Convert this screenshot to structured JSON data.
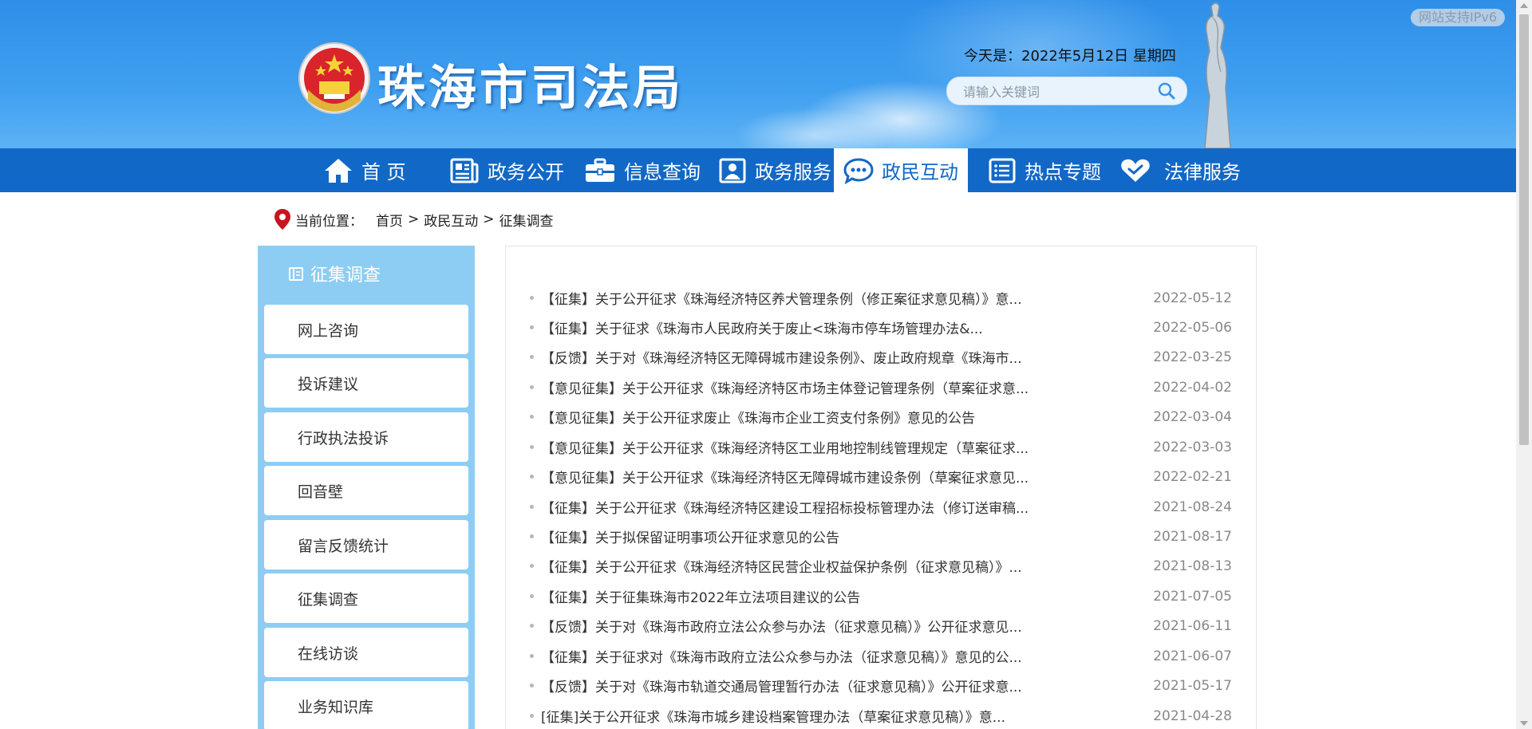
{
  "header": {
    "site_title": "珠海市司法局",
    "date_text": "今天是：2022年5月12日 星期四",
    "search_placeholder": "请输入关键词",
    "ipv6_badge": "网站支持IPv6"
  },
  "nav": {
    "items": [
      {
        "label": "首 页",
        "icon": "home-icon"
      },
      {
        "label": "政务公开",
        "icon": "newspaper-icon"
      },
      {
        "label": "信息查询",
        "icon": "briefcase-icon"
      },
      {
        "label": "政务服务",
        "icon": "user-card-icon"
      },
      {
        "label": "政民互动",
        "icon": "chat-bubble-icon",
        "active": true
      },
      {
        "label": "热点专题",
        "icon": "list-icon"
      },
      {
        "label": "法律服务",
        "icon": "heart-icon"
      }
    ]
  },
  "breadcrumb": {
    "label": "当前位置：",
    "items": [
      "首页",
      "政民互动",
      "征集调查"
    ],
    "separator": ">"
  },
  "sidebar": {
    "title": "征集调查",
    "items": [
      "网上咨询",
      "投诉建议",
      "行政执法投诉",
      "回音壁",
      "留言反馈统计",
      "征集调查",
      "在线访谈",
      "业务知识库"
    ]
  },
  "list": {
    "items": [
      {
        "title": "【征集】关于公开征求《珠海经济特区养犬管理条例（修正案征求意见稿）》意...",
        "date": "2022-05-12"
      },
      {
        "title": "【征集】关于征求《珠海市人民政府关于废止<珠海市停车场管理办法&...",
        "date": "2022-05-06"
      },
      {
        "title": "【反馈】关于对《珠海经济特区无障碍城市建设条例》、废止政府规章《珠海市...",
        "date": "2022-03-25"
      },
      {
        "title": "【意见征集】关于公开征求《珠海经济特区市场主体登记管理条例（草案征求意...",
        "date": "2022-04-02"
      },
      {
        "title": "【意见征集】关于公开征求废止《珠海市企业工资支付条例》意见的公告",
        "date": "2022-03-04"
      },
      {
        "title": "【意见征集】关于公开征求《珠海经济特区工业用地控制线管理规定（草案征求...",
        "date": "2022-03-03"
      },
      {
        "title": "【意见征集】关于公开征求《珠海经济特区无障碍城市建设条例（草案征求意见...",
        "date": "2022-02-21"
      },
      {
        "title": "【征集】关于公开征求《珠海经济特区建设工程招标投标管理办法（修订送审稿...",
        "date": "2021-08-24"
      },
      {
        "title": "【征集】关于拟保留证明事项公开征求意见的公告",
        "date": "2021-08-17"
      },
      {
        "title": "【征集】关于公开征求《珠海经济特区民营企业权益保护条例（征求意见稿）》...",
        "date": "2021-08-13"
      },
      {
        "title": "【征集】关于征集珠海市2022年立法项目建议的公告",
        "date": "2021-07-05"
      },
      {
        "title": "【反馈】关于对《珠海市政府立法公众参与办法（征求意见稿）》公开征求意见...",
        "date": "2021-06-11"
      },
      {
        "title": "【征集】关于征求对《珠海市政府立法公众参与办法（征求意见稿）》意见的公...",
        "date": "2021-06-07"
      },
      {
        "title": "【反馈】关于对《珠海市轨道交通局管理暂行办法（征求意见稿）》公开征求意...",
        "date": "2021-05-17"
      },
      {
        "title": "[征集]关于公开征求《珠海市城乡建设档案管理办法（草案征求意见稿）》意...",
        "date": "2021-04-28"
      }
    ]
  },
  "colors": {
    "nav_bg": "#1268c6",
    "sidebar_bg": "#8dcdf4",
    "banner_blue": "#3f9ff0",
    "date_gray": "#888888"
  }
}
